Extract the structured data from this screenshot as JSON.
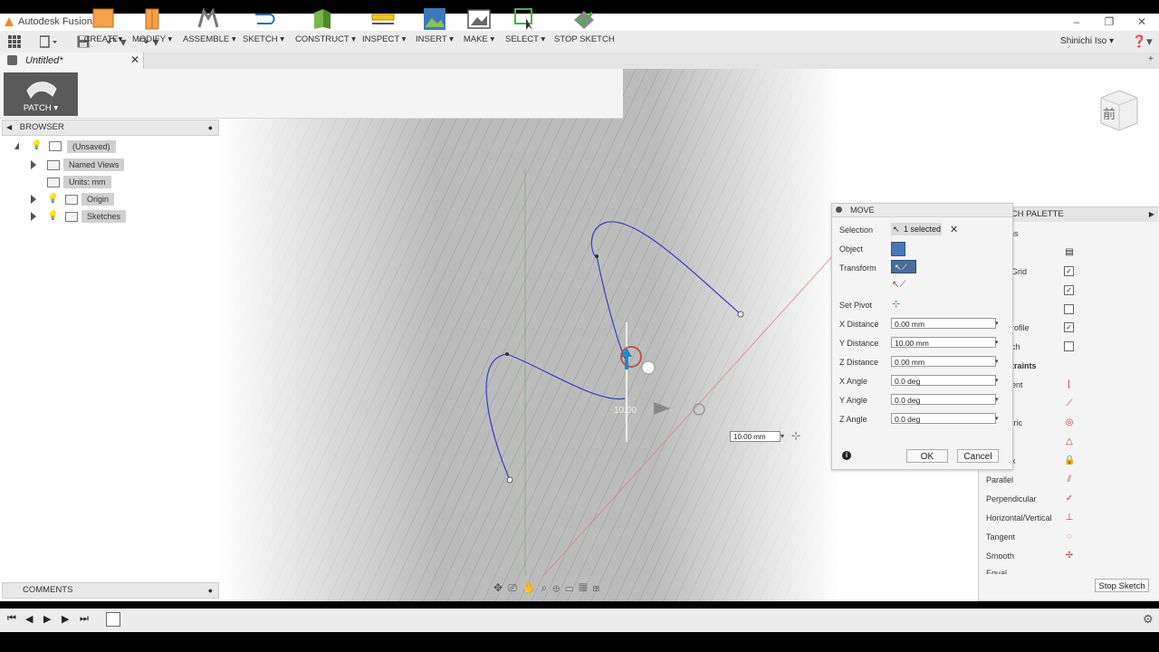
{
  "window": {
    "title": "Autodesk Fusion 360"
  },
  "user": {
    "name": "Shinichi Iso"
  },
  "document_tab": {
    "label": "Untitled*"
  },
  "toolbar": {
    "workspace": "PATCH",
    "tools": [
      "CREATE",
      "MODIFY",
      "ASSEMBLE",
      "SKETCH",
      "CONSTRUCT",
      "INSPECT",
      "INSERT",
      "MAKE",
      "SELECT",
      "STOP SKETCH"
    ]
  },
  "browser": {
    "title": "BROWSER",
    "root": "(Unsaved)",
    "items": [
      "Named Views",
      "Units: mm",
      "Origin",
      "Sketches"
    ]
  },
  "comments": {
    "title": "COMMENTS"
  },
  "viewcube": {
    "face": "前"
  },
  "move_dialog": {
    "title": "MOVE",
    "selection_label": "Selection",
    "selection_value": "1 selected",
    "object_label": "Object",
    "transform_label": "Transform",
    "set_pivot_label": "Set Pivot",
    "fields": [
      {
        "label": "X Distance",
        "value": "0.00 mm"
      },
      {
        "label": "Y Distance",
        "value": "10.00 mm"
      },
      {
        "label": "Z Distance",
        "value": "0.00 mm"
      },
      {
        "label": "X Angle",
        "value": "0.0 deg"
      },
      {
        "label": "Y Angle",
        "value": "0.0 deg"
      },
      {
        "label": "Z Angle",
        "value": "0.0 deg"
      }
    ],
    "ok_label": "OK",
    "cancel_label": "Cancel"
  },
  "canvas": {
    "distance_input": "10.00 mm",
    "manipulator_label": "10.00"
  },
  "sketch_palette": {
    "title": "TCH PALETTE",
    "options_partial": [
      "ns",
      "Grid",
      "rofile",
      "ch"
    ],
    "constraints_partial": "traints",
    "constraints_partial_items": [
      "ent",
      "",
      "tric",
      "",
      "x"
    ],
    "constraints": [
      "Parallel",
      "Perpendicular",
      "Horizontal/Vertical",
      "Tangent",
      "Smooth",
      "Equal"
    ],
    "stop_sketch_label": "Stop Sketch"
  },
  "colors": {
    "sketch_curve": "#3a3fc4",
    "accent_blue": "#1e88c8",
    "grid_line": "#9a9a9a"
  }
}
